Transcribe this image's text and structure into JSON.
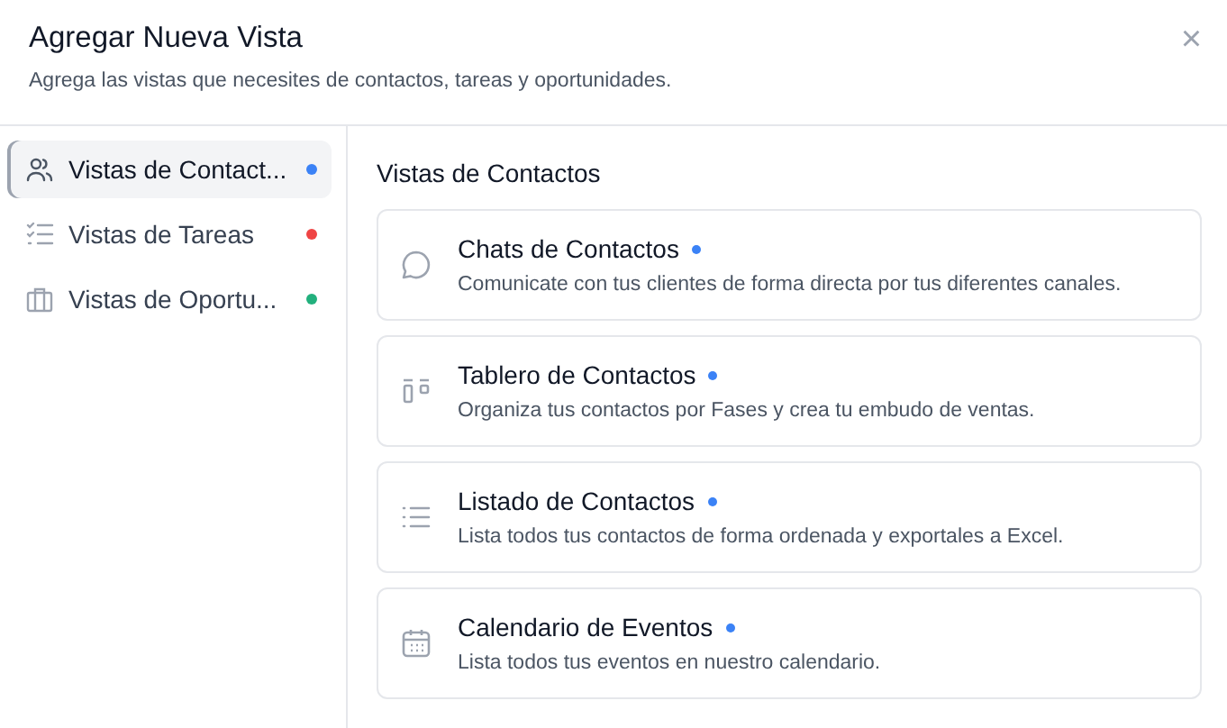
{
  "dialog": {
    "title": "Agregar Nueva Vista",
    "subtitle": "Agrega las vistas que necesites de contactos, tareas y oportunidades.",
    "close": "×"
  },
  "sidebar": {
    "items": [
      {
        "kind": "people",
        "label": "Vistas de Contact...",
        "color": "#3b82f6",
        "selected": true
      },
      {
        "kind": "tasks",
        "label": "Vistas de Tareas",
        "color": "#ef4444",
        "selected": false
      },
      {
        "kind": "briefcase",
        "label": "Vistas de Oportu...",
        "color": "#22b07d",
        "selected": false
      }
    ]
  },
  "section": {
    "title": "Vistas de Contactos",
    "cards": [
      {
        "kind": "chat",
        "title": "Chats de Contactos",
        "description": "Comunicate con tus clientes de forma directa por tus diferentes canales."
      },
      {
        "kind": "board",
        "title": "Tablero de Contactos",
        "description": "Organiza tus contactos por Fases y crea tu embudo de ventas."
      },
      {
        "kind": "list",
        "title": "Listado de Contactos",
        "description": "Lista todos tus contactos de forma ordenada y exportales a Excel."
      },
      {
        "kind": "calendar",
        "title": "Calendario de Eventos",
        "description": "Lista todos tus eventos en nuestro calendario."
      }
    ]
  }
}
